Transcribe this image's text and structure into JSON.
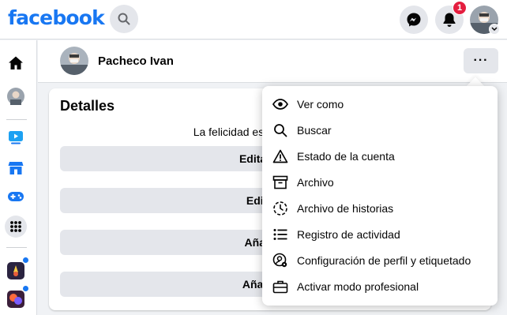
{
  "topbar": {
    "logo": "facebook",
    "notifications_count": "1"
  },
  "profile": {
    "name": "Pacheco Ivan",
    "more_label": "···"
  },
  "details": {
    "title": "Detalles",
    "bio": "La felicidad es un Tesoro",
    "buttons": [
      "Editar p",
      "Edita",
      "Añadi",
      "Añadir"
    ]
  },
  "menu": {
    "items": [
      {
        "label": "Ver como",
        "icon": "eye-icon"
      },
      {
        "label": "Buscar",
        "icon": "search-icon"
      },
      {
        "label": "Estado de la cuenta",
        "icon": "warning-icon"
      },
      {
        "label": "Archivo",
        "icon": "archive-icon"
      },
      {
        "label": "Archivo de historias",
        "icon": "story-archive-icon"
      },
      {
        "label": "Registro de actividad",
        "icon": "list-icon"
      },
      {
        "label": "Configuración de perfil y etiquetado",
        "icon": "profile-settings-icon"
      },
      {
        "label": "Activar modo profesional",
        "icon": "briefcase-icon"
      }
    ]
  },
  "colors": {
    "brand": "#1877f2",
    "badge": "#e41e3f",
    "button_gray": "#e4e6eb",
    "page_bg": "#f0f2f5"
  }
}
